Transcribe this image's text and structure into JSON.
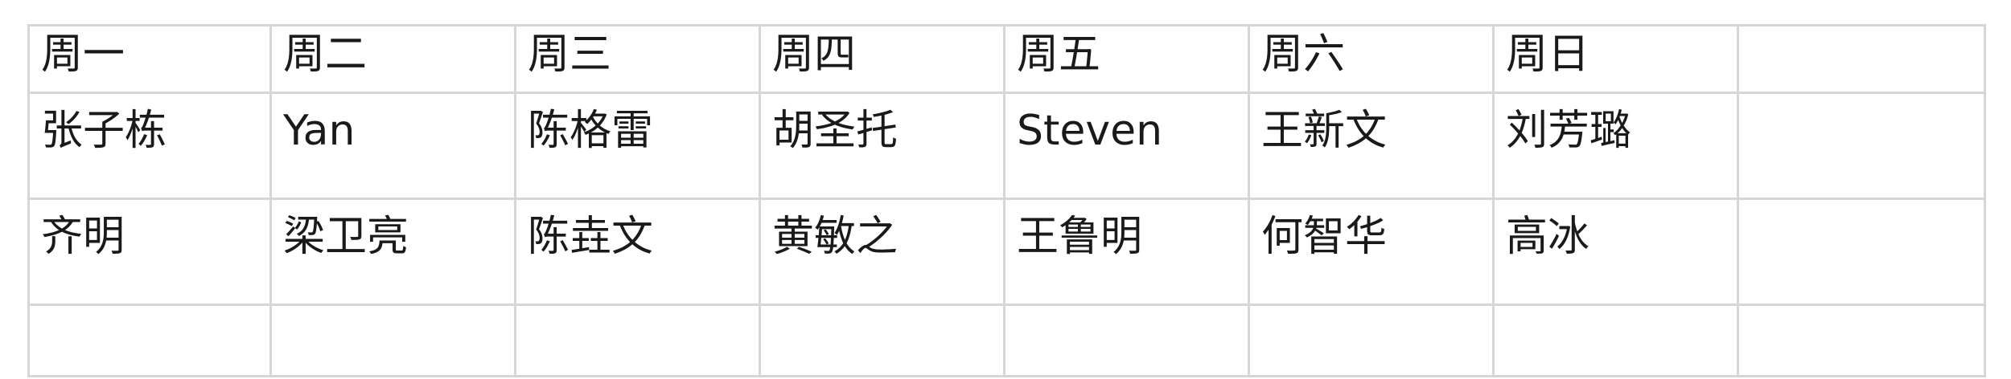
{
  "table": {
    "headers": [
      "周一",
      "周二",
      "周三",
      "周四",
      "周五",
      "周六",
      "周日",
      ""
    ],
    "rows": [
      [
        "张子栋",
        "Yan",
        "陈格雷",
        "胡圣托",
        "Steven",
        "王新文",
        "刘芳璐",
        ""
      ],
      [
        "齐明",
        "梁卫亮",
        "陈垚文",
        "黄敏之",
        "王鲁明",
        "何智华",
        "高冰",
        ""
      ],
      [
        "",
        "",
        "",
        "",
        "",
        "",
        "",
        ""
      ]
    ]
  }
}
